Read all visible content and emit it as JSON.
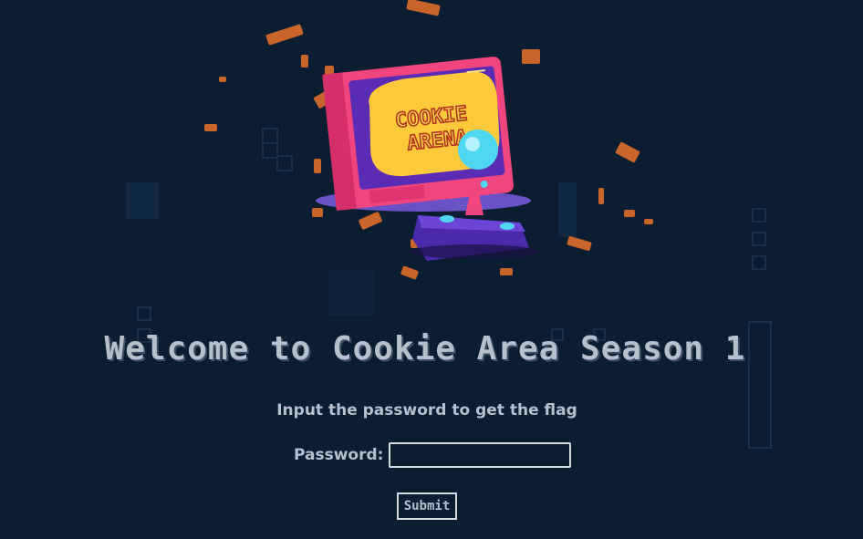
{
  "hero": {
    "logo_line1": "COOKIE",
    "logo_line2": "ARENA"
  },
  "main": {
    "title": "Welcome to Cookie Area Season 1",
    "subtitle": "Input the password to get the flag",
    "password_label": "Password:",
    "password_value": "",
    "submit_label": "Submit"
  },
  "colors": {
    "background": "#0b1e31",
    "text": "#b5c0cf",
    "tv_body": "#f0457e",
    "tv_screen_bg": "#5a2bb3",
    "logo_bubble": "#ffc93c",
    "joystick_ball": "#4fd6f0",
    "crumb": "#c9642a"
  }
}
